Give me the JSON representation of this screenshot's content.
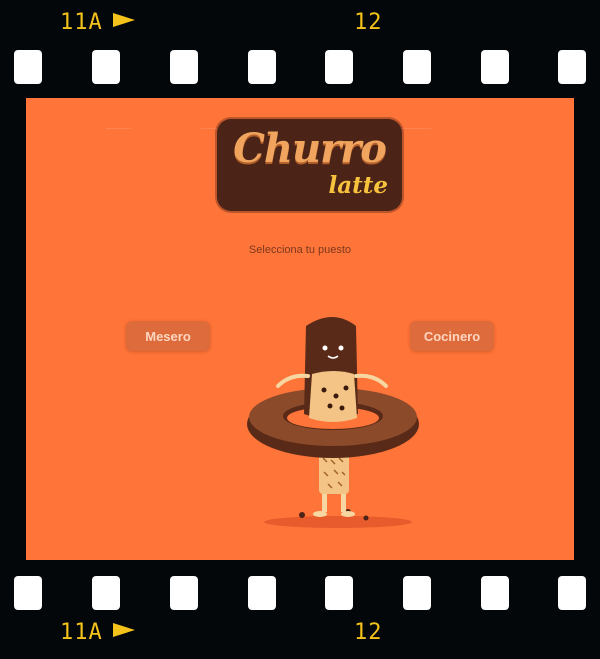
{
  "film": {
    "frame_left": "11A",
    "frame_right": "12"
  },
  "app": {
    "logo_main": "Churro",
    "logo_sub": "latte",
    "prompt": "Selecciona tu puesto",
    "roles": {
      "waiter_label": "Mesero",
      "cook_label": "Cocinero"
    }
  },
  "colors": {
    "background": "#ff7438",
    "logo_bg": "#4b2317",
    "logo_text": "#f0a45e",
    "logo_sub_text": "#f7c23d",
    "button_bg": "#d86a3c",
    "film_label": "#f3c21b"
  },
  "icons": {
    "mascot": "churro-in-donut-illustration",
    "arrow": "right-triangle-arrow"
  }
}
